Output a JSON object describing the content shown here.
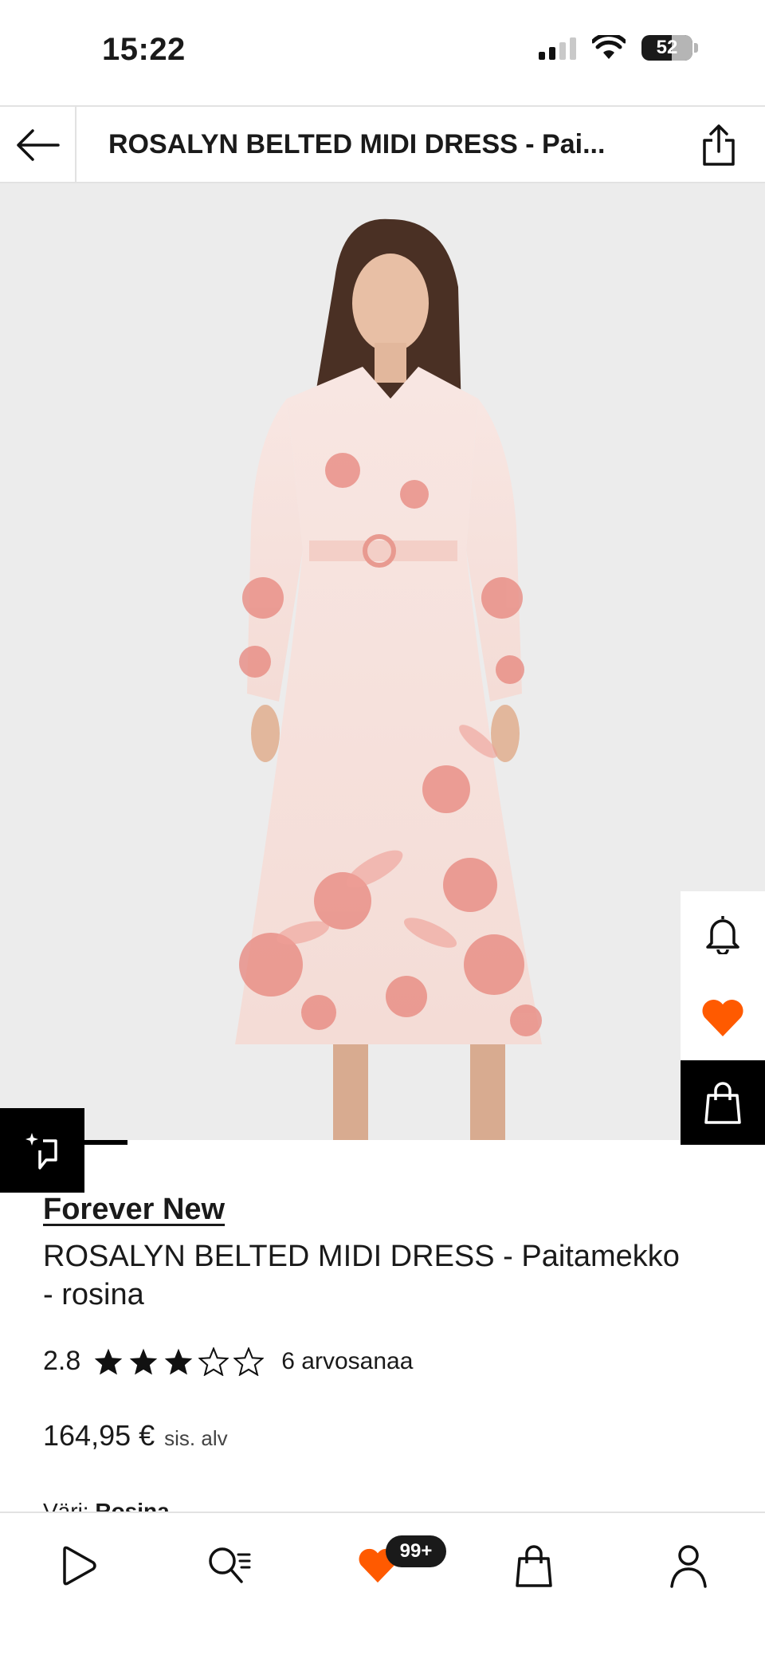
{
  "status_bar": {
    "time": "15:22",
    "battery": "52"
  },
  "header": {
    "title": "ROSALYN BELTED MIDI DRESS - Pai..."
  },
  "product": {
    "brand": "Forever New",
    "name": "ROSALYN BELTED MIDI DRESS - Paitamekko - rosina",
    "rating": "2.8",
    "rating_value": 2.8,
    "rating_count": "6 arvosanaa",
    "price": "164,95 €",
    "vat": "sis. alv",
    "color_label": "Väri:",
    "color_value": "Rosina"
  },
  "bottom_nav": {
    "wishlist_badge": "99+"
  },
  "colors": {
    "accent": "#ff5a00",
    "text": "#1a1a1a",
    "background": "#ffffff",
    "image_bg": "#ececec"
  },
  "icons": [
    "back-arrow-icon",
    "share-icon",
    "bell-icon",
    "heart-icon",
    "bag-icon",
    "similar-items-icon",
    "play-icon",
    "search-icon",
    "profile-icon"
  ]
}
